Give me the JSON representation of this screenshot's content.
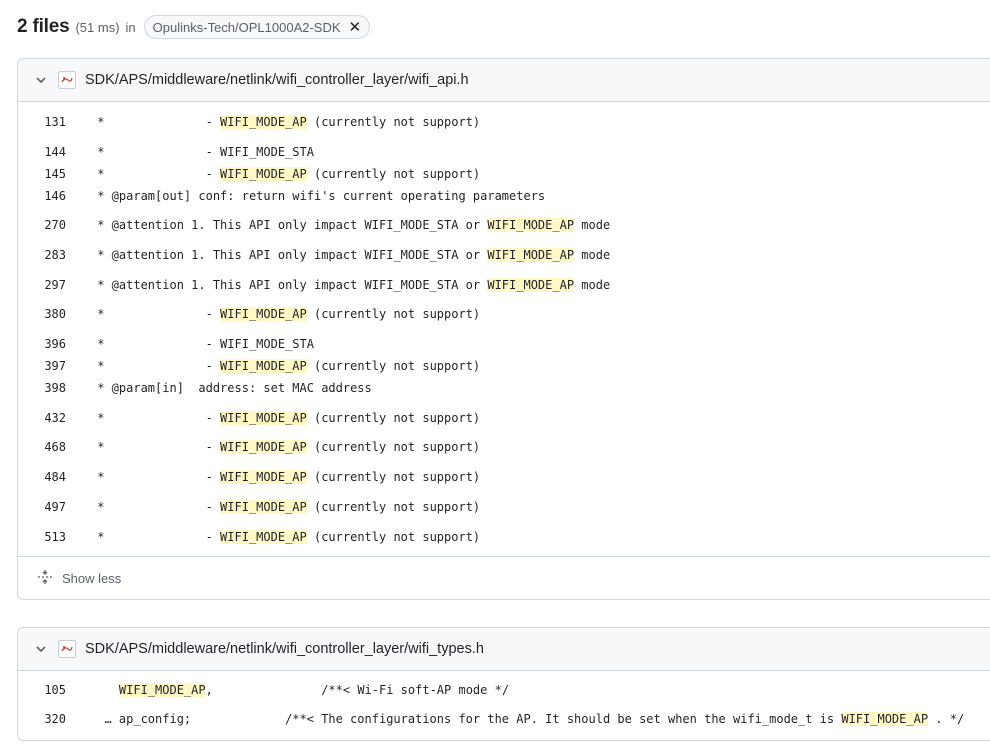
{
  "header": {
    "count": "2 files",
    "time": "(51 ms)",
    "in_label": "in",
    "repo": "Opulinks-Tech/OPL1000A2-SDK"
  },
  "files": [
    {
      "path": "SDK/APS/middleware/netlink/wifi_controller_layer/wifi_api.h",
      "lines": [
        {
          "num": "131",
          "pre": " *              - ",
          "hl": "WIFI_MODE_AP",
          "post": " (currently not support)"
        },
        {
          "num": "144",
          "pre": " *              - WIFI_MODE_STA",
          "hl": "",
          "post": ""
        },
        {
          "num": "145",
          "pre": " *              - ",
          "hl": "WIFI_MODE_AP",
          "post": " (currently not support)"
        },
        {
          "num": "146",
          "pre": " * @param[out] conf: return wifi's current operating parameters",
          "hl": "",
          "post": ""
        },
        {
          "num": "270",
          "pre": " * @attention 1. This API only impact WIFI_MODE_STA or ",
          "hl": "WIFI_MODE_AP",
          "post": " mode"
        },
        {
          "num": "283",
          "pre": " * @attention 1. This API only impact WIFI_MODE_STA or ",
          "hl": "WIFI_MODE_AP",
          "post": " mode"
        },
        {
          "num": "297",
          "pre": " * @attention 1. This API only impact WIFI_MODE_STA or ",
          "hl": "WIFI_MODE_AP",
          "post": " mode"
        },
        {
          "num": "380",
          "pre": " *              - ",
          "hl": "WIFI_MODE_AP",
          "post": " (currently not support)"
        },
        {
          "num": "396",
          "pre": " *              - WIFI_MODE_STA",
          "hl": "",
          "post": ""
        },
        {
          "num": "397",
          "pre": " *              - ",
          "hl": "WIFI_MODE_AP",
          "post": " (currently not support)"
        },
        {
          "num": "398",
          "pre": " * @param[in]  address: set MAC address",
          "hl": "",
          "post": ""
        },
        {
          "num": "432",
          "pre": " *              - ",
          "hl": "WIFI_MODE_AP",
          "post": " (currently not support)"
        },
        {
          "num": "468",
          "pre": " *              - ",
          "hl": "WIFI_MODE_AP",
          "post": " (currently not support)"
        },
        {
          "num": "484",
          "pre": " *              - ",
          "hl": "WIFI_MODE_AP",
          "post": " (currently not support)"
        },
        {
          "num": "497",
          "pre": " *              - ",
          "hl": "WIFI_MODE_AP",
          "post": " (currently not support)"
        },
        {
          "num": "513",
          "pre": " *              - ",
          "hl": "WIFI_MODE_AP",
          "post": " (currently not support)"
        }
      ],
      "show_less": "Show less"
    },
    {
      "path": "SDK/APS/middleware/netlink/wifi_controller_layer/wifi_types.h",
      "lines": [
        {
          "num": "105",
          "pre": "    ",
          "hl": "WIFI_MODE_AP",
          "post": ",               /**< Wi-Fi soft-AP mode */"
        },
        {
          "num": "320",
          "pre": "  … ap_config;             /**< The configurations for the AP. It should be set when the wifi_mode_t is ",
          "hl": "WIFI_MODE_AP",
          "post": " . */"
        }
      ]
    }
  ],
  "colors": {
    "highlight": "#fff8c5",
    "border": "#d1d9e0",
    "header_bg": "#f6f8fa",
    "muted": "#59636e"
  },
  "icons": {
    "chevron": "chevron-down-icon",
    "file": "file-image-icon",
    "close": "close-icon",
    "fold": "fold-icon"
  }
}
